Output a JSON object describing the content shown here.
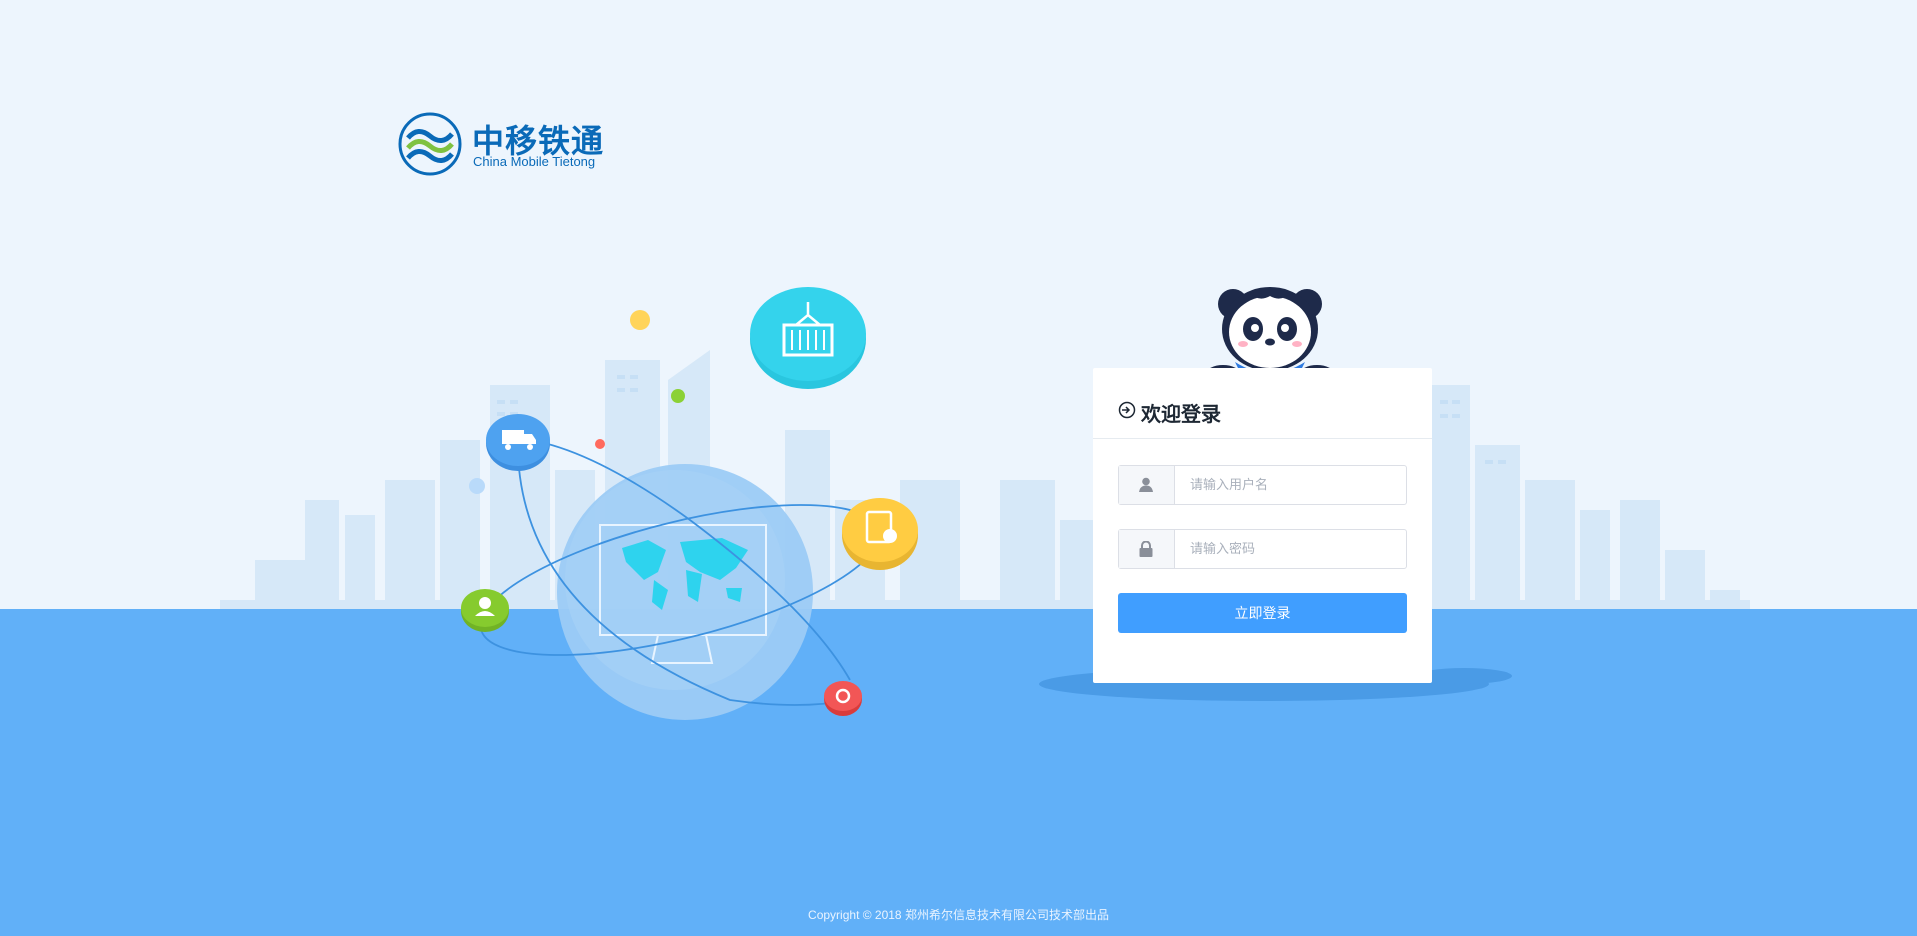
{
  "brand": {
    "name_cn": "中移铁通",
    "name_en": "China Mobile Tietong"
  },
  "login": {
    "title": "欢迎登录",
    "username_placeholder": "请输入用户名",
    "password_placeholder": "请输入密码",
    "submit_label": "立即登录"
  },
  "footer": {
    "copyright": "Copyright  ©  2018 郑州希尔信息技术有限公司技术部出品"
  },
  "icons": {
    "logo": "china-mobile-tietong-logo",
    "login": "login-arrow-icon",
    "user": "user-icon",
    "lock": "lock-icon",
    "illustration": [
      "container-icon",
      "truck-icon",
      "checklist-icon",
      "customer-service-icon",
      "gear-icon",
      "world-map-icon"
    ]
  },
  "colors": {
    "sky": "#edf5fd",
    "ground": "#61b0f8",
    "brand_blue": "#0a6ab8",
    "button": "#409eff"
  }
}
